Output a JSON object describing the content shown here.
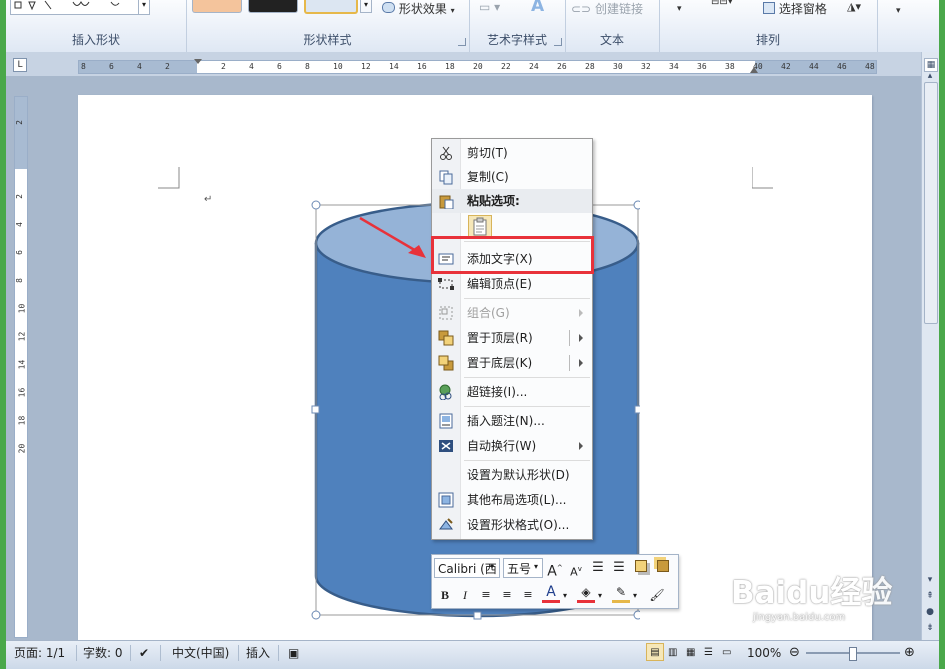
{
  "ribbon": {
    "groups": [
      {
        "label": "插入形状"
      },
      {
        "label": "形状样式"
      },
      {
        "label": "艺术字样式"
      },
      {
        "label": "文本"
      },
      {
        "label": "排列"
      }
    ],
    "shape_effects_label": "形状效果",
    "create_link_label": "创建链接",
    "selection_pane_label": "选择窗格",
    "wordart_glyph": "A"
  },
  "ruler": {
    "corner_glyph": "L",
    "h_ticks": [
      "8",
      "6",
      "4",
      "2",
      "2",
      "4",
      "6",
      "8",
      "10",
      "12",
      "14",
      "16",
      "18",
      "20",
      "22",
      "24",
      "26",
      "28",
      "30",
      "32",
      "34",
      "36",
      "38",
      "40",
      "42",
      "44",
      "46",
      "48"
    ],
    "v_ticks": [
      "2",
      "2",
      "4",
      "6",
      "8",
      "10",
      "12",
      "14",
      "16",
      "18",
      "20"
    ]
  },
  "context_menu": {
    "items": [
      {
        "label": "剪切(T)",
        "icon": "scissors-icon"
      },
      {
        "label": "复制(C)",
        "icon": "copy-icon"
      },
      {
        "label": "粘贴选项:",
        "icon": "paste-icon"
      },
      {
        "label": "添加文字(X)",
        "icon": "add-text-icon"
      },
      {
        "label": "编辑顶点(E)",
        "icon": "edit-points-icon"
      },
      {
        "label": "组合(G)",
        "icon": "group-icon"
      },
      {
        "label": "置于顶层(R)",
        "icon": "bring-front-icon"
      },
      {
        "label": "置于底层(K)",
        "icon": "send-back-icon"
      },
      {
        "label": "超链接(I)...",
        "icon": "hyperlink-icon"
      },
      {
        "label": "插入题注(N)...",
        "icon": "caption-icon"
      },
      {
        "label": "自动换行(W)",
        "icon": "wrap-text-icon"
      },
      {
        "label": "设置为默认形状(D)",
        "icon": ""
      },
      {
        "label": "其他布局选项(L)...",
        "icon": "layout-options-icon"
      },
      {
        "label": "设置形状格式(O)...",
        "icon": "format-shape-icon"
      }
    ]
  },
  "mini_toolbar": {
    "font": "Calibri (西",
    "size": "五号",
    "grow_font": "A",
    "shrink_font": "A",
    "bold": "B",
    "italic": "I",
    "font_color_glyph": "A"
  },
  "status": {
    "page": "页面: 1/1",
    "words": "字数: 0",
    "language": "中文(中国)",
    "mode": "插入",
    "zoom": "100%",
    "zoom_level": 0.5
  },
  "watermark": {
    "text": "Baidu经验",
    "sub": "jingyan.baidu.com"
  },
  "colors": {
    "shape_fill": "#4f81bd",
    "shape_top": "#95b3d7",
    "shape_stroke": "#385d8a",
    "highlight": "#e8323a"
  }
}
